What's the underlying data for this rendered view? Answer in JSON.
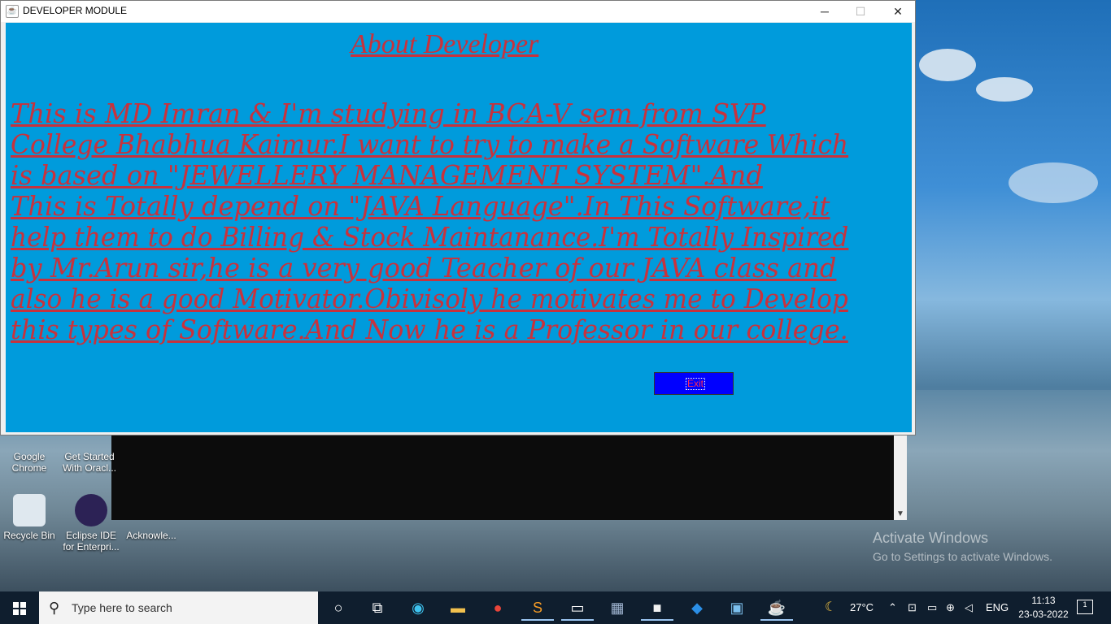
{
  "window": {
    "title": "DEVELOPER MODULE",
    "heading": "About Developer",
    "paragraph_lines": [
      "This is MD Imran & I'm studying in BCA-V sem from SVP",
      "College Bhabhua Kaimur.I want to try to make a Software Which",
      "is based on \"JEWELLERY  MANAGEMENT  SYSTEM\".And",
      "This is Totally depend on \"JAVA Language\".In This Software,it",
      "help them to do Billing & Stock Maintanance.I'm Totally Inspired",
      "by Mr.Arun sir,he is a very good Teacher of our JAVA class and",
      "also he is a good Motivator.Obivisoly he motivates me to Develop",
      "this types of Software.And Now he is a Professor in our college."
    ],
    "exit_label": "Exit",
    "minimize": "─",
    "maximize": "☐",
    "close": "✕",
    "colors": {
      "panel": "#009bdc",
      "text": "#c8323c",
      "exit_bg": "#0000ff"
    }
  },
  "desktop": {
    "icons": [
      {
        "label": "Google Chrome"
      },
      {
        "label": "Get Started With Oracl..."
      },
      {
        "label": "Recycle Bin"
      },
      {
        "label": "Eclipse IDE for Enterpri..."
      },
      {
        "label": "Acknowle..."
      }
    ],
    "activate_title": "Activate Windows",
    "activate_sub": "Go to Settings to activate Windows."
  },
  "taskbar": {
    "search_placeholder": "Type here to search",
    "weather": "27°C",
    "language": "ENG",
    "time": "11:13",
    "date": "23-03-2022",
    "notification_count": "1",
    "apps": [
      "cortana-icon",
      "task-view-icon",
      "edge-icon",
      "file-explorer-icon",
      "chrome-icon",
      "sublime-icon",
      "cmd-icon",
      "sql-icon",
      "intellij-icon",
      "vscode-icon",
      "control-panel-icon",
      "java-icon"
    ]
  }
}
